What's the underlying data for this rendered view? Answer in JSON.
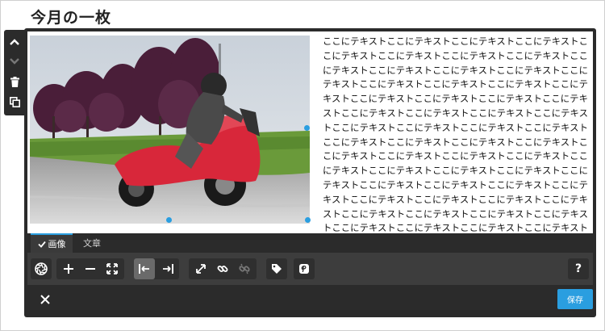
{
  "page": {
    "title": "今月の一枚"
  },
  "side_toolbar": {
    "items": [
      {
        "icon": "chevron-up-icon"
      },
      {
        "icon": "chevron-down-icon"
      },
      {
        "icon": "trash-icon"
      },
      {
        "icon": "duplicate-icon"
      }
    ]
  },
  "content": {
    "image": {
      "subject": "red scooter rider photo"
    },
    "text": "ここにテキストここにテキストここにテキストここにテキストここにテキストここにテキストここにテキストここにテキストここにテキストここにテキストここにテキストここにテキストここにテキストここにテキストここにテキストここにテキストここにテキストここにテキストここにテキストここにテキストここにテキストここにテキストここにテキストここにテキストここにテキストここにテキストここにテキストここにテキストここにテキストここにテキストここにテキストここにテキストここにテキストここにテキストここにテキストここにテキストここにテキストここにテキストここにテキストここにテキストここにテキストここにテキストここにテキストここにテキストここにテキストここにテキストここにテキストここにテキストここにテキストここにテキストここにテキストここにテキストここにテキストここにテキストここにテキストここにテキストここにテキストここにテキストここにテキストここにテキストここにテキストここにテキストここにテキストここにテキストここにテキストここにテキスト"
  },
  "tabs": [
    {
      "label": "画像",
      "active": true
    },
    {
      "label": "文章",
      "active": false
    }
  ],
  "toolbar": {
    "tools": [
      {
        "icon": "aperture-icon"
      },
      {
        "icon": "plus-icon"
      },
      {
        "icon": "minus-icon"
      },
      {
        "icon": "fit-icon"
      },
      {
        "icon": "align-left-icon"
      },
      {
        "icon": "align-right-icon"
      },
      {
        "icon": "expand-icon"
      },
      {
        "icon": "link-icon"
      },
      {
        "icon": "unlink-icon"
      },
      {
        "icon": "tag-icon"
      },
      {
        "icon": "pinterest-icon"
      },
      {
        "icon": "help-icon"
      }
    ],
    "help_label": "?"
  },
  "footer": {
    "close_icon": "close-icon",
    "save_label": "保存"
  },
  "colors": {
    "accent": "#2a9ee0",
    "toolbar_dark": "#2b2b2b",
    "toolbar_mid": "#3d3d3d"
  }
}
